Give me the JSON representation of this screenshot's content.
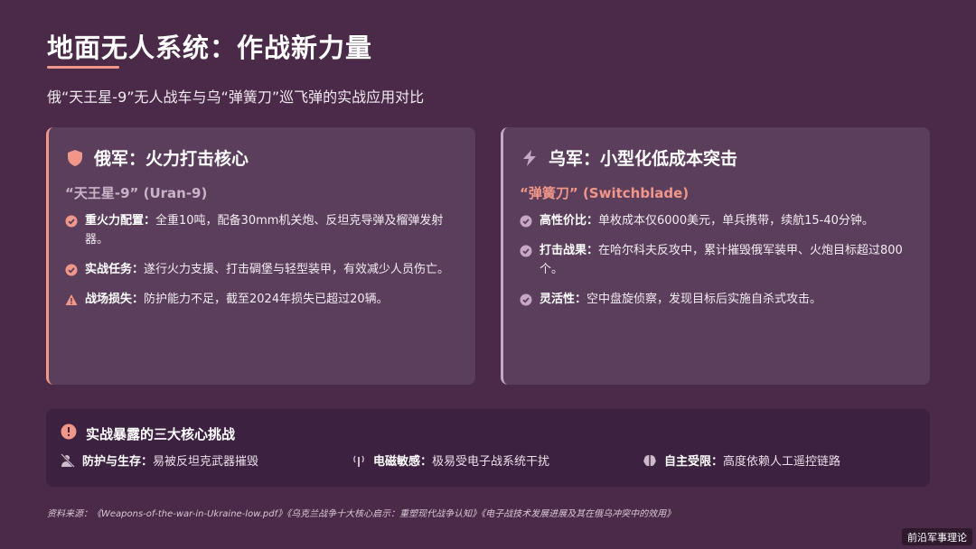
{
  "title": "地面无人系统：作战新力量",
  "subtitle": "俄“天王星-9”无人战车与乌“弹簧刀”巡飞弹的实战应用对比",
  "left_card": {
    "icon": "shield-icon",
    "title": "俄军：火力打击核心",
    "subtitle": "“天王星-9” (Uran-9)",
    "items": [
      {
        "icon": "check-circle-icon",
        "label": "重火力配置：",
        "text": "全重10吨，配备30mm机关炮、反坦克导弹及榴弹发射器。"
      },
      {
        "icon": "check-circle-icon",
        "label": "实战任务：",
        "text": "遂行火力支援、打击碉堡与轻型装甲，有效减少人员伤亡。"
      },
      {
        "icon": "warning-icon",
        "label": "战场损失：",
        "text": "防护能力不足，截至2024年损失已超过20辆。"
      }
    ]
  },
  "right_card": {
    "icon": "lightning-icon",
    "title": "乌军：小型化低成本突击",
    "subtitle": "“弹簧刀” (Switchblade)",
    "items": [
      {
        "icon": "check-circle-icon",
        "label": "高性价比：",
        "text": "单枚成本仅6000美元，单兵携带，续航15-40分钟。"
      },
      {
        "icon": "check-circle-icon",
        "label": "打击战果：",
        "text": "在哈尔科夫反攻中，累计摧毁俄军装甲、火炮目标超过800个。"
      },
      {
        "icon": "check-circle-icon",
        "label": "灵活性：",
        "text": "空中盘旋侦察，发现目标后实施自杀式攻击。"
      }
    ]
  },
  "challenges": {
    "icon": "exclamation-circle-icon",
    "title": "实战暴露的三大核心挑战",
    "items": [
      {
        "icon": "user-slash-icon",
        "label": "防护与生存：",
        "text": "易被反坦克武器摧毁"
      },
      {
        "icon": "signal-icon",
        "label": "电磁敏感：",
        "text": "极易受电子战系统干扰"
      },
      {
        "icon": "brain-icon",
        "label": "自主受限：",
        "text": "高度依赖人工遥控链路"
      }
    ]
  },
  "source": "资料来源：《Weapons-of-the-war-in-Ukraine-low.pdf》《乌克兰战争十大核心启示：重塑现代战争认知》《电子战技术发展进展及其在俄乌冲突中的效用》",
  "watermark": "前沿军事理论",
  "colors": {
    "background": "#4a2a48",
    "card": "#5b3e5b",
    "accent_left": "#f0978a",
    "accent_right": "#c8a7c6",
    "challenge_panel": "#3d2140"
  }
}
